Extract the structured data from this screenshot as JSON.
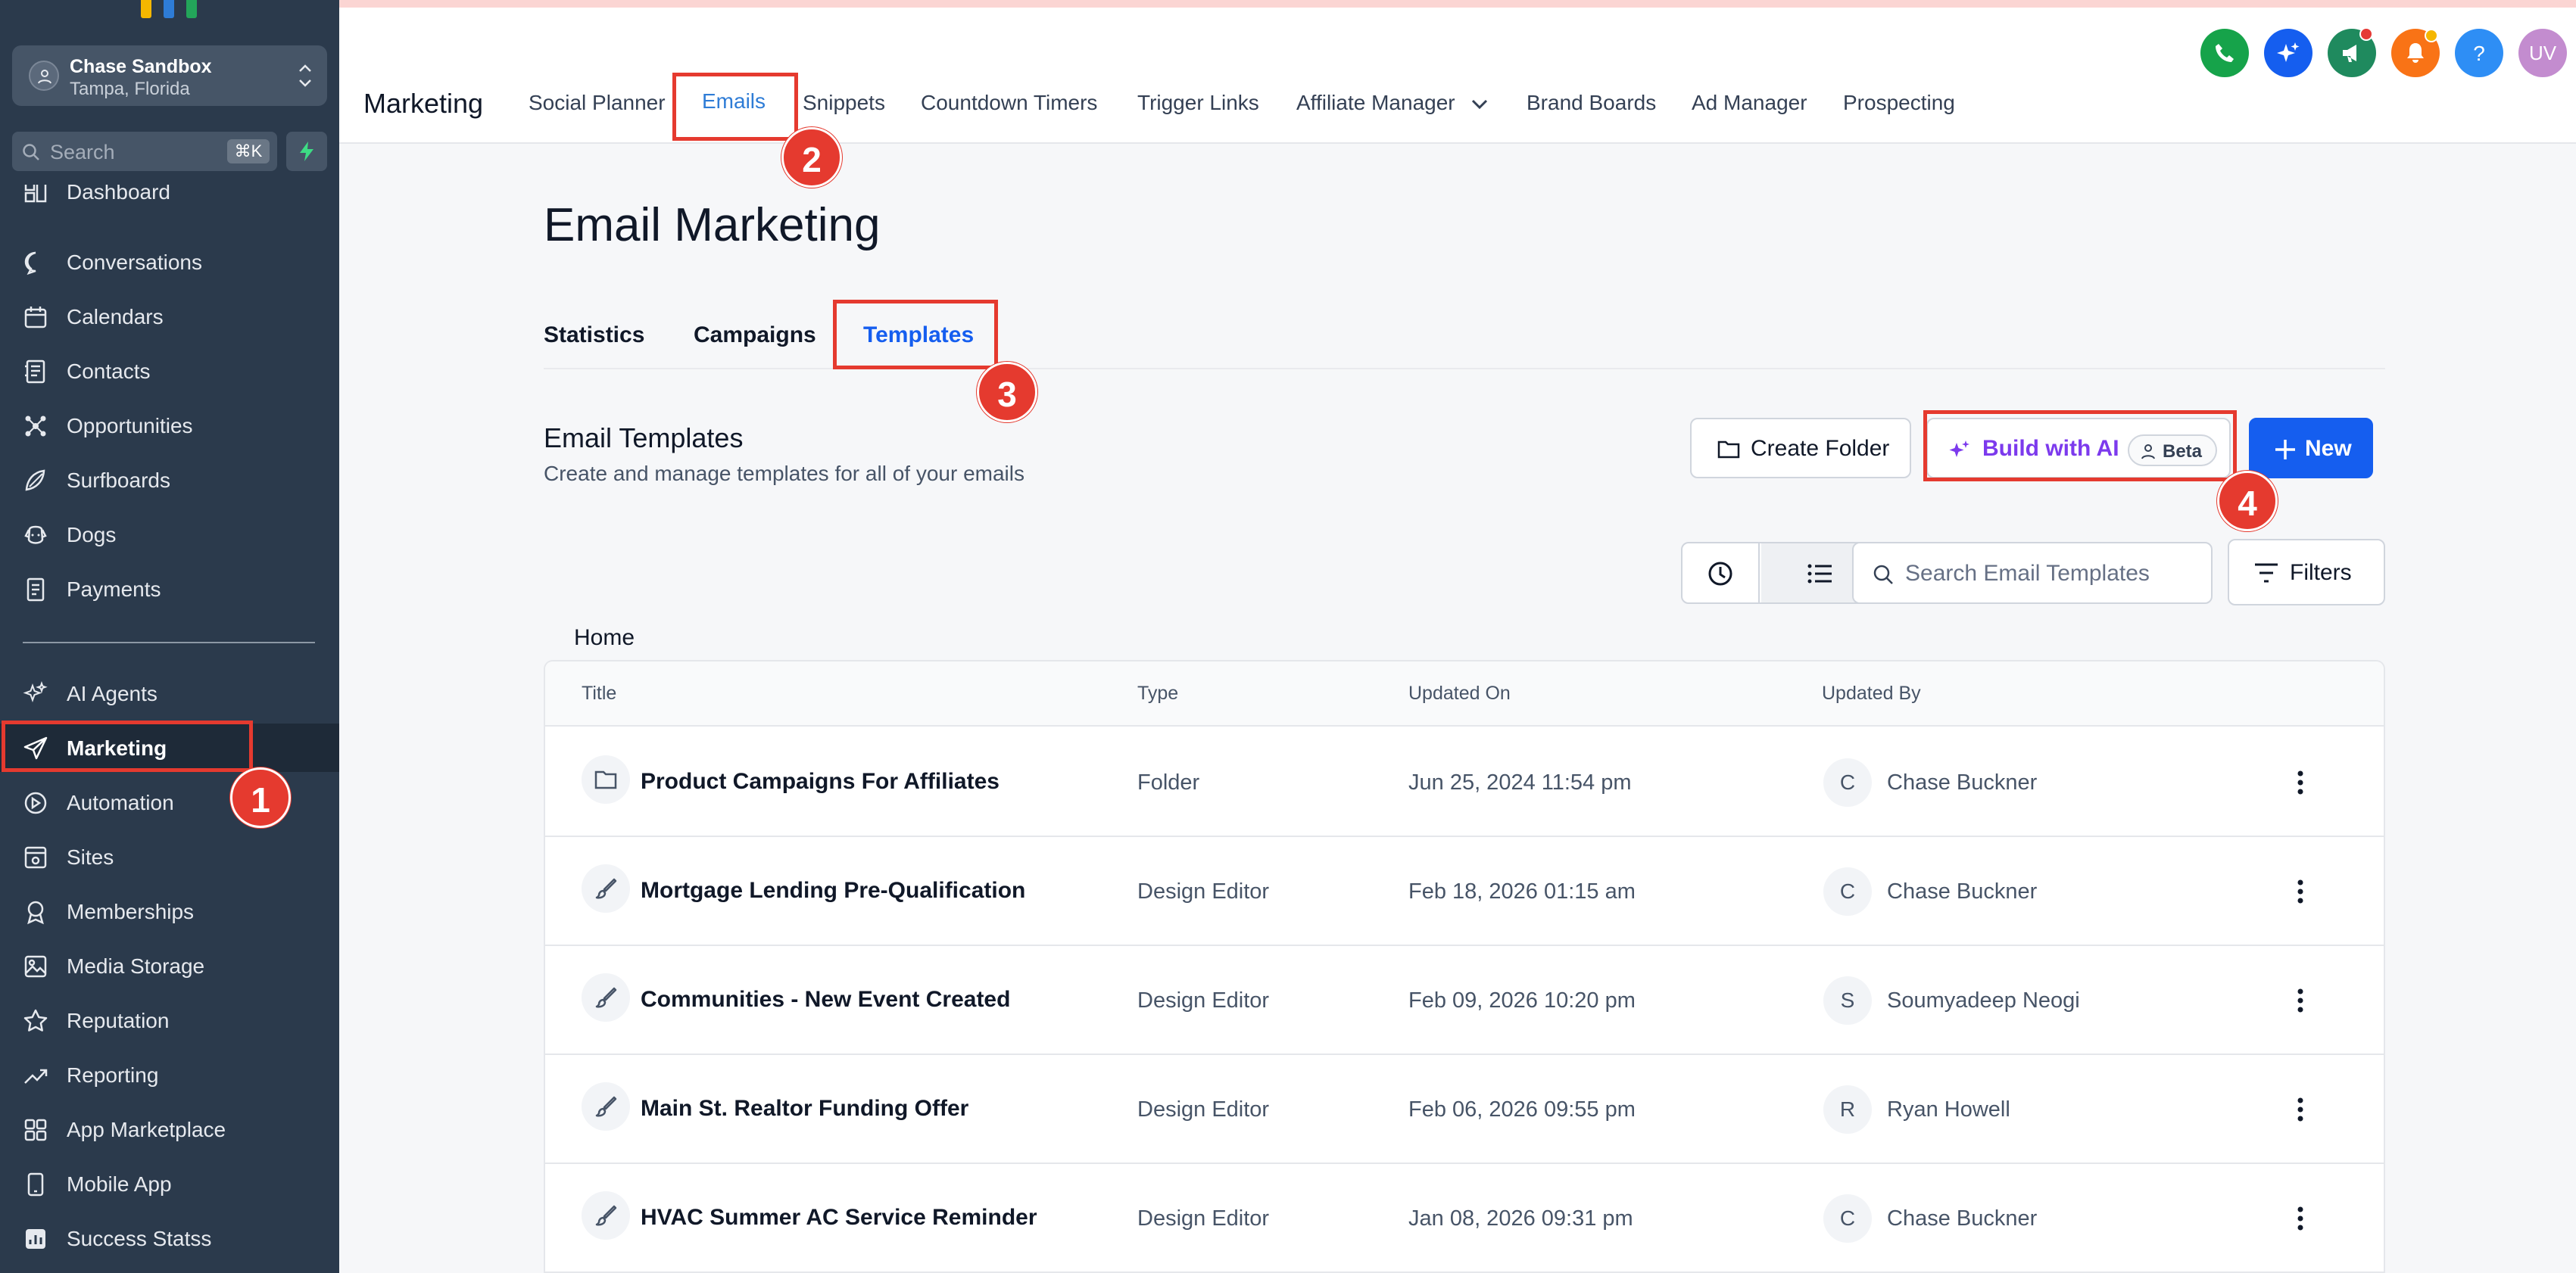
{
  "sidebar": {
    "account": {
      "name": "Chase Sandbox",
      "location": "Tampa, Florida"
    },
    "search": {
      "placeholder": "Search",
      "shortcut": "⌘K"
    },
    "items": [
      {
        "label": "Dashboard",
        "icon": "dashboard-icon"
      },
      {
        "label": "Conversations",
        "icon": "chat-bubble-icon"
      },
      {
        "label": "Calendars",
        "icon": "calendar-icon"
      },
      {
        "label": "Contacts",
        "icon": "contacts-book-icon"
      },
      {
        "label": "Opportunities",
        "icon": "network-icon"
      },
      {
        "label": "Surfboards",
        "icon": "surfboard-icon"
      },
      {
        "label": "Dogs",
        "icon": "dog-icon"
      },
      {
        "label": "Payments",
        "icon": "invoice-icon"
      },
      {
        "label": "AI Agents",
        "icon": "sparkle-icon"
      },
      {
        "label": "Marketing",
        "icon": "paper-plane-icon",
        "active": true
      },
      {
        "label": "Automation",
        "icon": "automation-icon"
      },
      {
        "label": "Sites",
        "icon": "sites-icon"
      },
      {
        "label": "Memberships",
        "icon": "badge-icon"
      },
      {
        "label": "Media Storage",
        "icon": "image-icon"
      },
      {
        "label": "Reputation",
        "icon": "star-icon"
      },
      {
        "label": "Reporting",
        "icon": "trend-icon"
      },
      {
        "label": "App Marketplace",
        "icon": "grid-icon"
      },
      {
        "label": "Mobile App",
        "icon": "phone-icon"
      },
      {
        "label": "Success Statss",
        "icon": "stats-icon"
      }
    ]
  },
  "header": {
    "title": "Marketing",
    "nav": [
      "Social Planner",
      "Emails",
      "Snippets",
      "Countdown Timers",
      "Trigger Links",
      "Affiliate Manager",
      "Brand Boards",
      "Ad Manager",
      "Prospecting"
    ],
    "active_nav": "Emails",
    "user_initials": "UV"
  },
  "main": {
    "page_title": "Email Marketing",
    "tabs": [
      "Statistics",
      "Campaigns",
      "Templates"
    ],
    "active_tab": "Templates",
    "section_title": "Email Templates",
    "section_subtitle": "Create and manage templates for all of your emails",
    "buttons": {
      "create_folder": "Create Folder",
      "build_ai": "Build with AI",
      "beta": "Beta",
      "new": "New",
      "filters": "Filters"
    },
    "search_placeholder": "Search Email Templates",
    "breadcrumb": "Home",
    "table": {
      "headers": [
        "Title",
        "Type",
        "Updated On",
        "Updated By"
      ],
      "rows": [
        {
          "title": "Product Campaigns For Affiliates",
          "type": "Folder",
          "updated_on": "Jun 25, 2024 11:54 pm",
          "initial": "C",
          "updated_by": "Chase Buckner"
        },
        {
          "title": "Mortgage Lending Pre-Qualification",
          "type": "Design Editor",
          "updated_on": "Feb 18, 2026 01:15 am",
          "initial": "C",
          "updated_by": "Chase Buckner"
        },
        {
          "title": "Communities - New Event Created",
          "type": "Design Editor",
          "updated_on": "Feb 09, 2026 10:20 pm",
          "initial": "S",
          "updated_by": "Soumyadeep Neogi"
        },
        {
          "title": "Main St. Realtor Funding Offer",
          "type": "Design Editor",
          "updated_on": "Feb 06, 2026 09:55 pm",
          "initial": "R",
          "updated_by": "Ryan Howell"
        },
        {
          "title": "HVAC Summer AC Service Reminder",
          "type": "Design Editor",
          "updated_on": "Jan 08, 2026 09:31 pm",
          "initial": "C",
          "updated_by": "Chase Buckner"
        }
      ]
    }
  },
  "annotations": [
    "1",
    "2",
    "3",
    "4"
  ],
  "colors": {
    "sidebar_bg": "#2b3a4c",
    "primary": "#155eef",
    "ai_purple": "#7c3aed",
    "annotation_red": "#e53a2f",
    "active_nav": "#2e7cd6"
  }
}
